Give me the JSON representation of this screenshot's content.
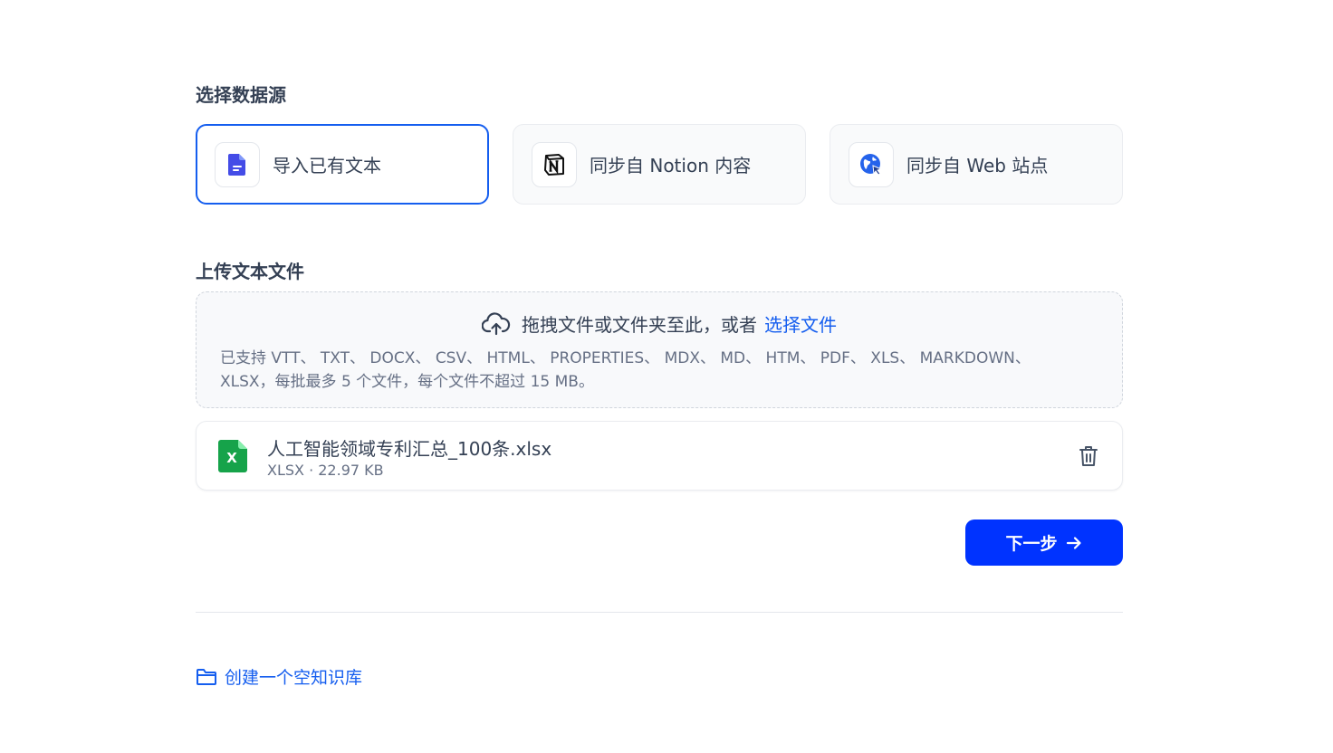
{
  "sections": {
    "data_source_title": "选择数据源",
    "upload_title": "上传文本文件"
  },
  "sources": [
    {
      "label": "导入已有文本",
      "icon": "document-icon",
      "selected": true
    },
    {
      "label": "同步自 Notion 内容",
      "icon": "notion-icon",
      "selected": false
    },
    {
      "label": "同步自 Web 站点",
      "icon": "web-icon",
      "selected": false
    }
  ],
  "dropzone": {
    "icon": "cloud-upload-icon",
    "prompt": "拖拽文件或文件夹至此，或者",
    "link": "选择文件",
    "hint": "已支持 VTT、 TXT、 DOCX、 CSV、 HTML、 PROPERTIES、 MDX、 MD、 HTM、 PDF、 XLS、 MARKDOWN、 XLSX，每批最多 5 个文件，每个文件不超过 15 MB。"
  },
  "file": {
    "name": "人工智能领域专利汇总_100条.xlsx",
    "meta": "XLSX · 22.97 KB",
    "icon_letter": "X",
    "icon": "xlsx-file-icon"
  },
  "next_button": {
    "label": "下一步"
  },
  "create_link": {
    "label": "创建一个空知识库"
  },
  "colors": {
    "accent": "#155eef",
    "primary_button": "#0033ff",
    "excel_green": "#16a34a"
  }
}
